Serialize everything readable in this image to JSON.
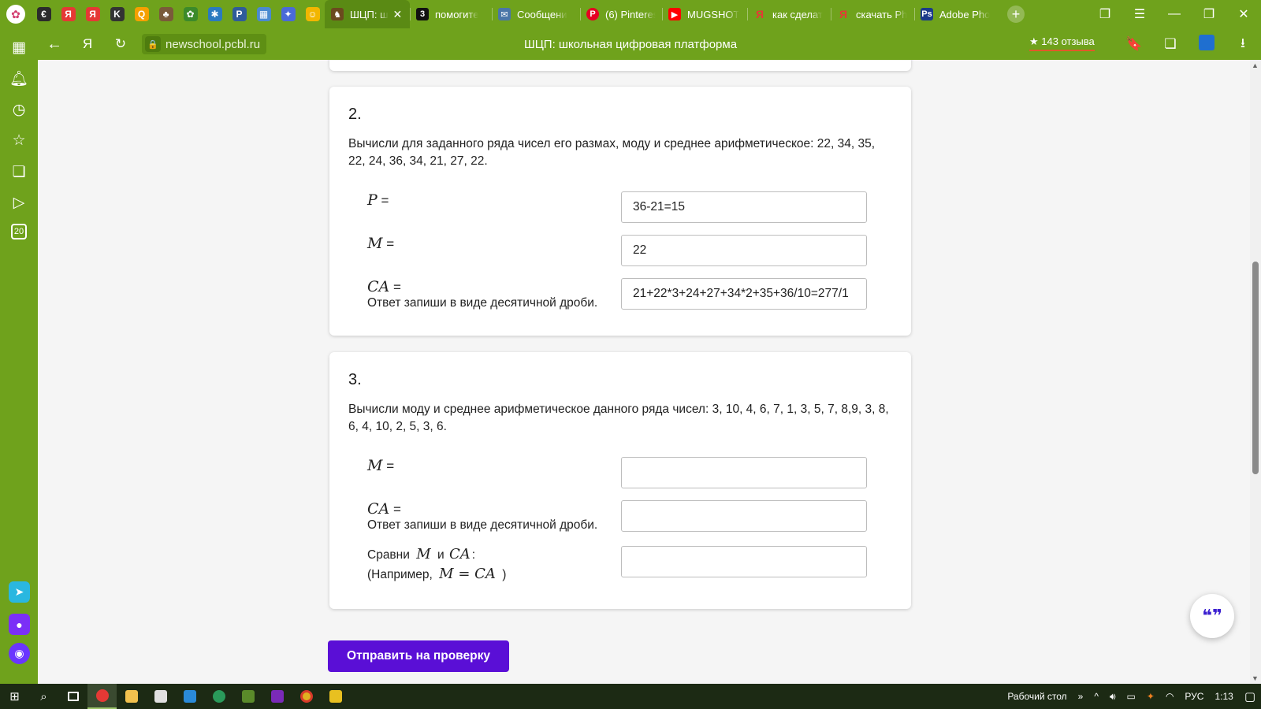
{
  "browser": {
    "tabs": [
      {
        "label": "ШЦП: ш",
        "icon": "shcp-favicon",
        "color": "#6b4a1e",
        "active": true
      },
      {
        "label": "помогите",
        "icon": "znanija-favicon",
        "color": "#111111"
      },
      {
        "label": "Сообщени",
        "icon": "chat-favicon",
        "color": "#4a76a8"
      },
      {
        "label": "(6) Pinteres",
        "icon": "pinterest-favicon",
        "color": "#e60023"
      },
      {
        "label": "MUGSHOT",
        "icon": "youtube-favicon",
        "color": "#ff0000"
      },
      {
        "label": "как сделат",
        "icon": "yandex-favicon",
        "color": "#f33"
      },
      {
        "label": "скачать Ph",
        "icon": "yandex-favicon",
        "color": "#f33"
      },
      {
        "label": "Adobe Pho",
        "icon": "photoshop-favicon",
        "color": "#1b3a8a"
      }
    ],
    "pinned": [
      {
        "icon": "pinned-site-icon",
        "glyph": "€",
        "color": "#2b2b2b"
      },
      {
        "icon": "yandex-icon",
        "glyph": "Я",
        "color": "#e53935"
      },
      {
        "icon": "yandex-icon",
        "glyph": "Я",
        "color": "#e53935"
      },
      {
        "icon": "kinopoisk-icon",
        "glyph": "K",
        "color": "#333333"
      },
      {
        "icon": "q-icon",
        "glyph": "Q",
        "color": "#f5a000"
      },
      {
        "icon": "game-icon",
        "glyph": "♣",
        "color": "#7a5a3a"
      },
      {
        "icon": "gear-icon",
        "glyph": "✿",
        "color": "#3c8a2a"
      },
      {
        "icon": "pinwheel-icon",
        "glyph": "✱",
        "color": "#2a7ac0"
      },
      {
        "icon": "pinned-site-icon",
        "glyph": "P",
        "color": "#2f5c9a"
      },
      {
        "icon": "apps-icon",
        "glyph": "▦",
        "color": "#4a8ad0"
      },
      {
        "icon": "star-icon",
        "glyph": "✦",
        "color": "#4a6ad8"
      },
      {
        "icon": "smile-icon",
        "glyph": "☺",
        "color": "#f2b600"
      }
    ],
    "url": "newschool.pcbl.ru",
    "page_title": "ШЦП: школьная цифровая платформа",
    "reviews": "★ 143 отзыва"
  },
  "task2": {
    "number": "2.",
    "text": "Вычисли для заданного ряда чисел его размах, моду и среднее арифметическое: 22, 34, 35, 22, 24, 36, 34, 21, 27, 22.",
    "rows": [
      {
        "var": "P",
        "eq": " =",
        "value": "36-21=15"
      },
      {
        "var": "M",
        "eq": " =",
        "value": "22"
      },
      {
        "var": "CA",
        "eq": " =",
        "value": "21+22*3+24+27+34*2+35+36/10=277/1"
      }
    ],
    "hint": "Ответ запиши в виде десятичной дроби."
  },
  "task3": {
    "number": "3.",
    "text": "Вычисли моду и среднее арифметическое данного ряда чисел: 3, 10, 4, 6, 7, 1, 3, 5, 7, 8,9, 3, 8, 6, 4, 10, 2, 5, 3, 6.",
    "rows": [
      {
        "var": "M",
        "eq": " =",
        "value": ""
      },
      {
        "var": "CA",
        "eq": " =",
        "value": ""
      }
    ],
    "hint": "Ответ запиши в виде десятичной дроби.",
    "compare_prefix": "Сравни",
    "compare_a": "M",
    "compare_mid": "и",
    "compare_b": "CA",
    "compare_suffix": ":",
    "example_prefix": "(Например,",
    "example_expr": "M = CA",
    "example_suffix": ")",
    "compare_value": ""
  },
  "submit_label": "Отправить на проверку",
  "taskbar": {
    "desktop_label": "Рабочий стол",
    "lang": "РУС",
    "time": "1:13"
  }
}
